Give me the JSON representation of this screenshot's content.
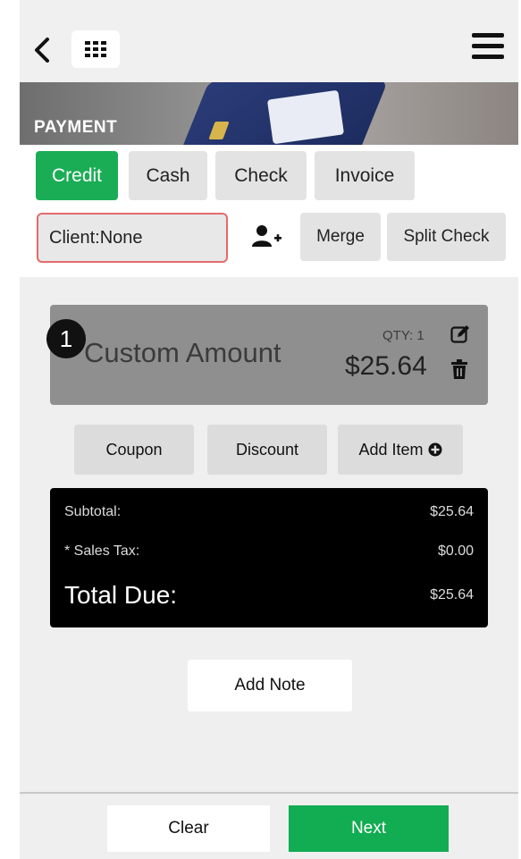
{
  "header": {
    "back_icon": "chevron-left-icon",
    "grid_icon": "grid-icon",
    "menu_icon": "hamburger-menu-icon"
  },
  "banner": {
    "title": "PAYMENT"
  },
  "payment_tabs": [
    {
      "label": "Credit",
      "active": true
    },
    {
      "label": "Cash",
      "active": false
    },
    {
      "label": "Check",
      "active": false
    },
    {
      "label": "Invoice",
      "active": false
    }
  ],
  "client": {
    "value": "Client:None",
    "add_icon": "add-user-icon"
  },
  "actions_top": {
    "merge": "Merge",
    "split": "Split Check"
  },
  "item": {
    "index": "1",
    "name": "Custom Amount",
    "qty": "QTY: 1",
    "price": "$25.64",
    "edit_icon": "edit-icon",
    "delete_icon": "trash-icon"
  },
  "item_actions": {
    "coupon": "Coupon",
    "discount": "Discount",
    "add_item": "Add Item"
  },
  "totals": {
    "subtotal_label": "Subtotal:",
    "subtotal_value": "$25.64",
    "tax_label": "* Sales Tax:",
    "tax_value": "$0.00",
    "total_label": "Total Due:",
    "total_value": "$25.64"
  },
  "note": {
    "label": "Add Note"
  },
  "footer": {
    "clear": "Clear",
    "next": "Next"
  },
  "colors": {
    "accent": "#1aad55",
    "error_border": "#e36b6b",
    "totals_bg": "#000000"
  }
}
